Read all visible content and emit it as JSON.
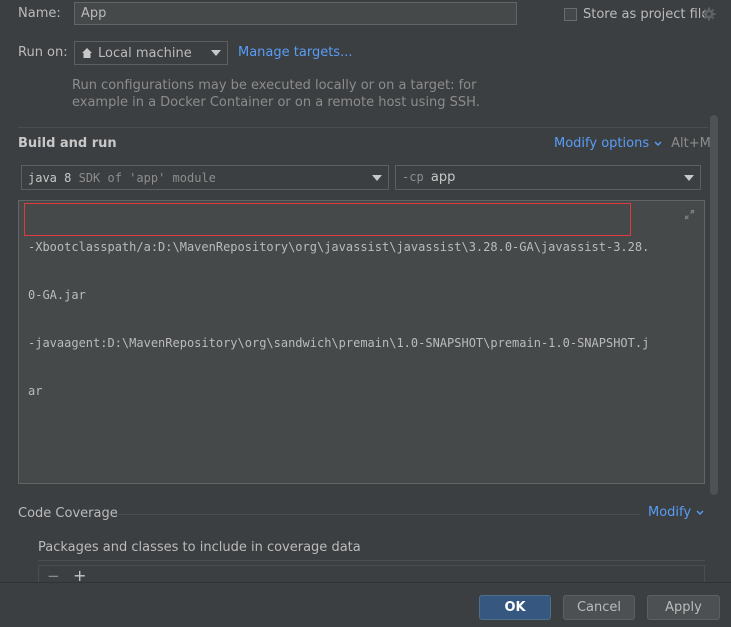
{
  "name_field": {
    "label": "Name:",
    "value": "App"
  },
  "store_as_project": {
    "label": "Store as project file",
    "checked": false
  },
  "run_on": {
    "label": "Run on:",
    "value": "Local machine",
    "manage_link": "Manage targets..."
  },
  "run_hint": {
    "line1": "Run configurations may be executed locally or on a target: for",
    "line2": "example in a Docker Container or on a remote host using SSH."
  },
  "build_and_run": {
    "title": "Build and run",
    "modify_options": "Modify options",
    "shortcut": "Alt+M",
    "sdk_combo": {
      "java": "java 8",
      "hint": "SDK of 'app' module"
    },
    "cp_combo": {
      "prefix": "-cp",
      "value": "app"
    },
    "vm_options": {
      "line1": "-Xbootclasspath/a:D:\\MavenRepository\\org\\javassist\\javassist\\3.28.0-GA\\javassist-3.28.",
      "line2": "0-GA.jar",
      "line3": "-javaagent:D:\\MavenRepository\\org\\sandwich\\premain\\1.0-SNAPSHOT\\premain-1.0-SNAPSHOT.j",
      "line4": "ar"
    }
  },
  "code_coverage": {
    "title": "Code Coverage",
    "modify": "Modify",
    "packages_label": "Packages and classes to include in coverage data",
    "remove": "−",
    "add": "+"
  },
  "footer": {
    "ok": "OK",
    "cancel": "Cancel",
    "apply": "Apply"
  },
  "colors": {
    "background": "#3c3f41",
    "link": "#589df6",
    "highlight_border": "#e0393e",
    "primary_button": "#365880"
  }
}
